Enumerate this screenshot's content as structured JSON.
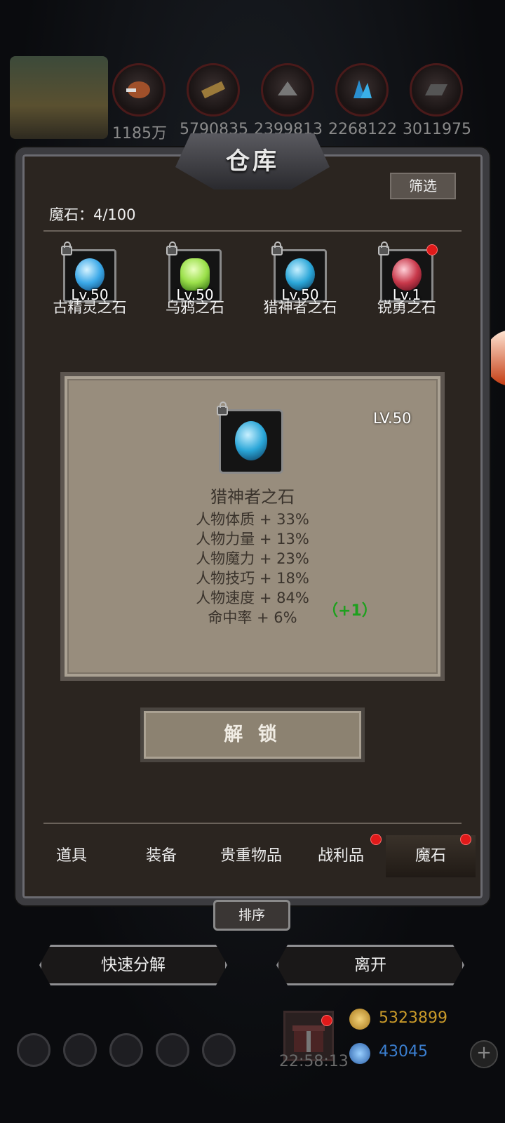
{
  "resources": {
    "values": [
      "1185万",
      "5790835",
      "2399813",
      "2268122",
      "3011975"
    ],
    "icon_names": [
      "meat-icon",
      "wood-icon",
      "stone-icon",
      "crystal-icon",
      "iron-icon"
    ]
  },
  "window": {
    "title": "仓库",
    "filter_label": "筛选",
    "count_label": "魔石：4/100"
  },
  "stones": [
    {
      "name": "古精灵之石",
      "level": "Lv.50",
      "color": "#3aa8e8",
      "locked": true,
      "badge": false
    },
    {
      "name": "乌鸦之石",
      "level": "Lv.50",
      "color": "#9be04a",
      "locked": true,
      "badge": false
    },
    {
      "name": "猎神者之石",
      "level": "Lv.50",
      "color": "#2aa6d8",
      "locked": true,
      "badge": false
    },
    {
      "name": "锐勇之石",
      "level": "Lv.1",
      "color": "#c8384a",
      "locked": true,
      "badge": true
    }
  ],
  "detail": {
    "level": "LV.50",
    "name": "猎神者之石",
    "stats": [
      "人物体质 + 33%",
      "人物力量 + 13%",
      "人物魔力 + 23%",
      "人物技巧 + 18%",
      "人物速度 + 84%",
      "命中率 + 6%"
    ],
    "bonus": "（+1）",
    "action_label": "解 锁"
  },
  "tabs": [
    {
      "label": "道具",
      "badge": false,
      "active": false
    },
    {
      "label": "装备",
      "badge": false,
      "active": false
    },
    {
      "label": "贵重物品",
      "badge": false,
      "active": false
    },
    {
      "label": "战利品",
      "badge": true,
      "active": false
    },
    {
      "label": "魔石",
      "badge": true,
      "active": true
    }
  ],
  "sort_label": "排序",
  "buttons": {
    "quick_decompose": "快速分解",
    "leave": "离开"
  },
  "hud": {
    "timer": "22:58:13",
    "gold": "5323899",
    "gems": "43045",
    "colors": {
      "gold": "#c99a2a",
      "gems": "#3b7fd0"
    }
  }
}
